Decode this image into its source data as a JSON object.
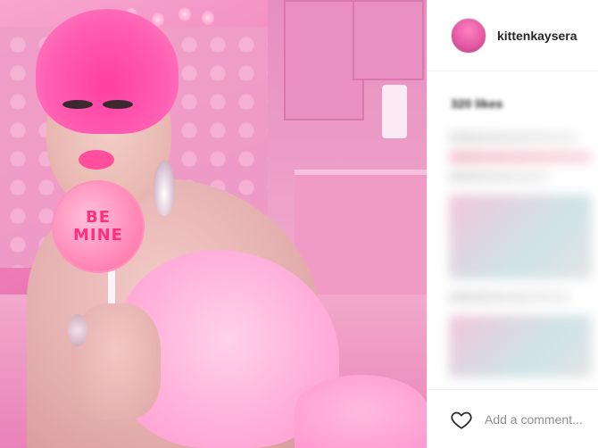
{
  "post": {
    "image_alt": "",
    "lollipop_text": [
      "BE",
      "MINE"
    ]
  },
  "sidebar": {
    "username": "kittenkaysera",
    "likes": "320 likes",
    "comment_placeholder": "Add a comment..."
  },
  "icons": {
    "like": "heart-icon",
    "avatar": "profile-avatar"
  },
  "colors": {
    "text": "#262626",
    "muted": "#8e8e8e",
    "border": "#efefef"
  }
}
